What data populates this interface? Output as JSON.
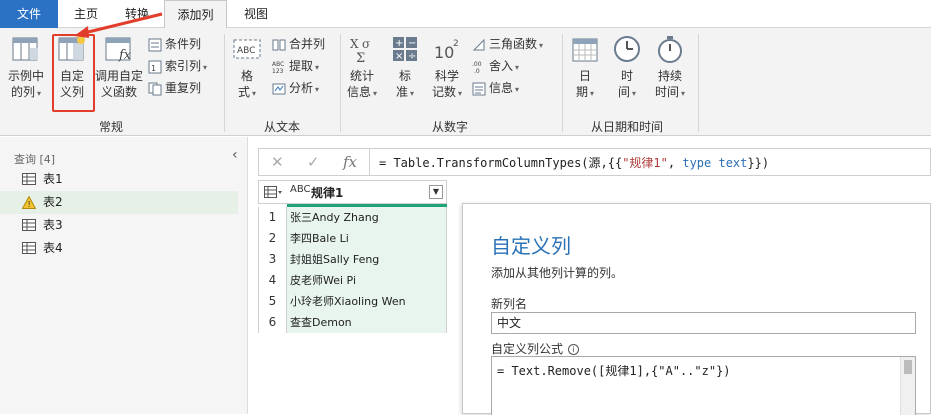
{
  "tabs": [
    {
      "label": "文件"
    },
    {
      "label": "主页"
    },
    {
      "label": "转换"
    },
    {
      "label": "添加列"
    },
    {
      "label": "视图"
    }
  ],
  "ribbon": {
    "general": {
      "label": "常规",
      "example_col": [
        "示例中",
        "的列"
      ],
      "custom_col": [
        "自定",
        "义列"
      ],
      "invoke_fn": [
        "调用自定",
        "义函数"
      ],
      "conditional_col": "条件列",
      "index_col": "索引列",
      "duplicate_col": "重复列"
    },
    "from_text": {
      "label": "从文本",
      "format": [
        "格",
        "式"
      ],
      "merge_cols": "合并列",
      "extract": "提取",
      "parse": "分析"
    },
    "from_number": {
      "label": "从数字",
      "statistics": [
        "统计",
        "信息"
      ],
      "standard": [
        "标",
        "准"
      ],
      "scientific": [
        "科学",
        "记数"
      ],
      "trig": "三角函数",
      "rounding": "舍入",
      "information": "信息"
    },
    "from_datetime": {
      "label": "从日期和时间",
      "date": [
        "日",
        "期"
      ],
      "time": [
        "时",
        "间"
      ],
      "duration": [
        "持续",
        "时间"
      ]
    }
  },
  "queries": {
    "title": "查询 [4]",
    "items": [
      {
        "label": "表1"
      },
      {
        "label": "表2"
      },
      {
        "label": "表3"
      },
      {
        "label": "表4"
      }
    ]
  },
  "formula_bar": {
    "prefix": "= Table.TransformColumnTypes(源,{{",
    "string": "\"规律1\"",
    "sep": ", ",
    "type_kw": "type",
    "type_name": " text",
    "suffix": "}})"
  },
  "grid": {
    "column_type": "ABC",
    "column_header": "规律1",
    "rows": [
      {
        "n": "1",
        "v": "张三Andy Zhang"
      },
      {
        "n": "2",
        "v": "李四Bale Li"
      },
      {
        "n": "3",
        "v": "封姐姐Sally Feng"
      },
      {
        "n": "4",
        "v": "皮老师Wei Pi"
      },
      {
        "n": "5",
        "v": "小玲老师Xiaoling Wen"
      },
      {
        "n": "6",
        "v": "查查Demon"
      }
    ]
  },
  "dialog": {
    "title": "自定义列",
    "subtitle": "添加从其他列计算的列。",
    "new_col_label": "新列名",
    "new_col_value": "中文",
    "formula_label": "自定义列公式",
    "formula": "= Text.Remove([规律1],{\"A\"..\"z\"})"
  },
  "colors": {
    "accent": "#2b72c4",
    "highlight": "#e23c2a",
    "grid_cell": "#e8f5ee",
    "column_bar": "#20a27a"
  }
}
